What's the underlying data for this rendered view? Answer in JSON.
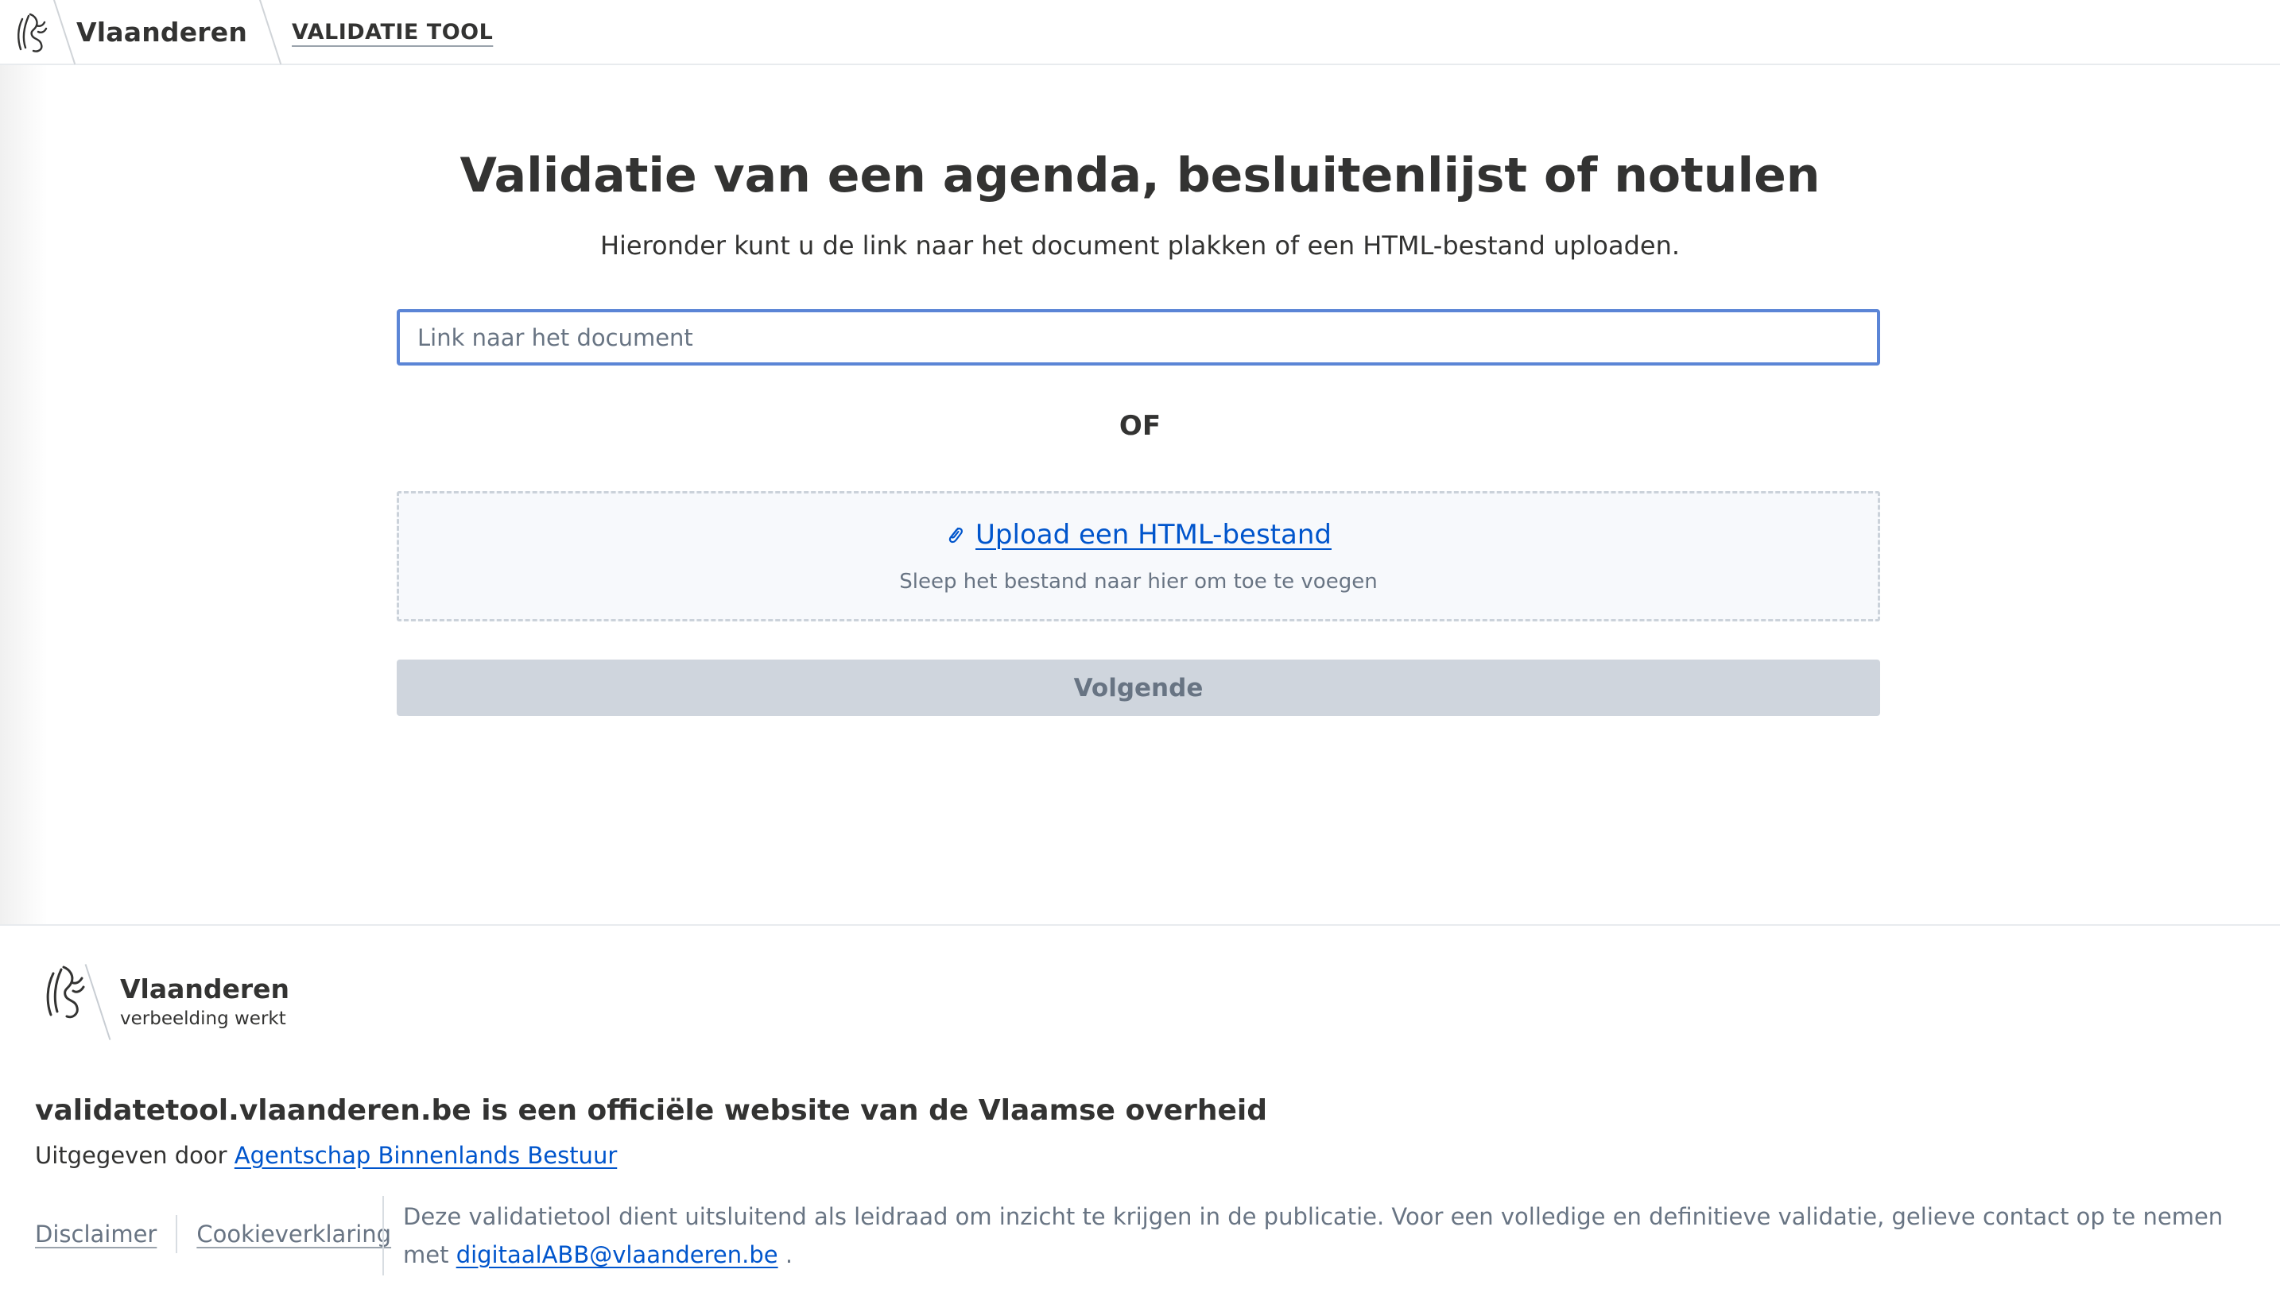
{
  "header": {
    "brand": "Vlaanderen",
    "app_name": "VALIDATIE TOOL",
    "logo_icon": "flemish-lion-icon"
  },
  "main": {
    "title": "Validatie van een agenda, besluitenlijst of notulen",
    "intro": "Hieronder kunt u de link naar het document plakken of een HTML-bestand uploaden.",
    "link_input": {
      "placeholder": "Link naar het document",
      "value": ""
    },
    "or_label": "OF",
    "upload": {
      "icon": "paperclip-icon",
      "link_label": "Upload een HTML-bestand",
      "hint": "Sleep het bestand naar hier om toe te voegen"
    },
    "next_button": {
      "label": "Volgende",
      "disabled": true
    }
  },
  "footer": {
    "brand": "Vlaanderen",
    "tagline": "verbeelding werkt",
    "logo_icon": "flemish-lion-icon",
    "title": "validatetool.vlaanderen.be is een officiële website van de Vlaamse overheid",
    "publisher_prefix": "Uitgegeven door",
    "publisher_link": "Agentschap Binnenlands Bestuur",
    "links": [
      "Disclaimer",
      "Cookieverklaring"
    ],
    "disclaimer_text": "Deze validatietool dient uitsluitend als leidraad om inzicht te krijgen in de publicatie. Voor een volledige en definitieve validatie, gelieve contact op te nemen met",
    "disclaimer_email": "digitaalABB@vlaanderen.be",
    "disclaimer_end": "."
  },
  "colors": {
    "text": "#333332",
    "link": "#0055cc",
    "muted": "#687483",
    "input_focus_border": "#5b85d6",
    "button_disabled_bg": "#cfd5dd",
    "upload_bg": "#f7f9fc"
  }
}
